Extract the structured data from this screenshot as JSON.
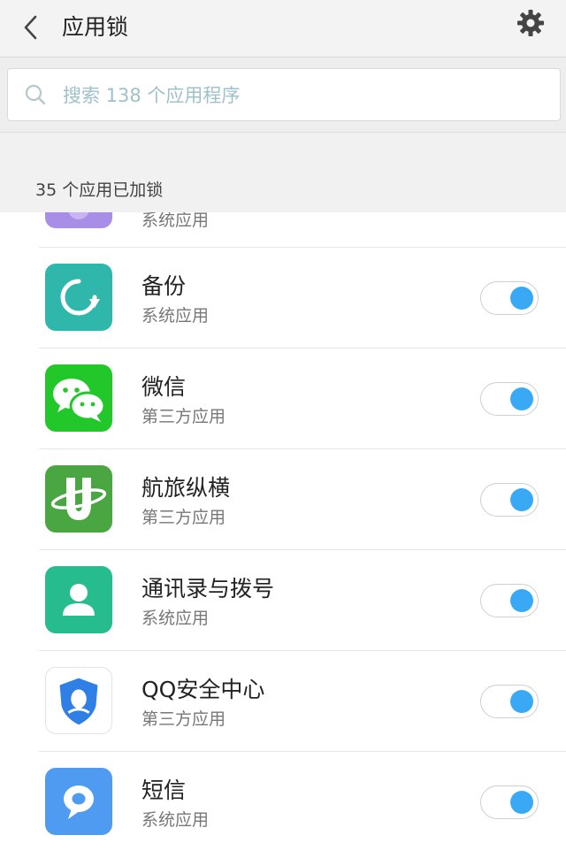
{
  "header": {
    "title": "应用锁",
    "back_icon": "chevron-left-icon",
    "settings_icon": "gear-icon"
  },
  "search": {
    "placeholder": "搜索 138 个应用程序",
    "icon": "search-icon"
  },
  "section": {
    "label": "35 个应用已加锁"
  },
  "partial_item": {
    "type": "系统应用",
    "icon_color": "#a98ee8",
    "locked": true
  },
  "items": [
    {
      "name": "备份",
      "type": "系统应用",
      "icon": "backup-icon",
      "icon_color": "#2fb7ac",
      "locked": true
    },
    {
      "name": "微信",
      "type": "第三方应用",
      "icon": "wechat-icon",
      "icon_color": "#22c72a",
      "locked": true
    },
    {
      "name": "航旅纵横",
      "type": "第三方应用",
      "icon": "umetrip-icon",
      "icon_color": "#4aa641",
      "locked": true
    },
    {
      "name": "通讯录与拨号",
      "type": "系统应用",
      "icon": "contacts-icon",
      "icon_color": "#26bc8e",
      "locked": true
    },
    {
      "name": "QQ安全中心",
      "type": "第三方应用",
      "icon": "qq-security-icon",
      "icon_color": "#2f7fe6",
      "locked": true
    },
    {
      "name": "短信",
      "type": "系统应用",
      "icon": "messages-icon",
      "icon_color": "#4f9bf2",
      "locked": true
    }
  ],
  "colors": {
    "toggle_on": "#3aa9f5",
    "header_bg": "#f3f3f3",
    "placeholder": "#9fc1c9"
  }
}
